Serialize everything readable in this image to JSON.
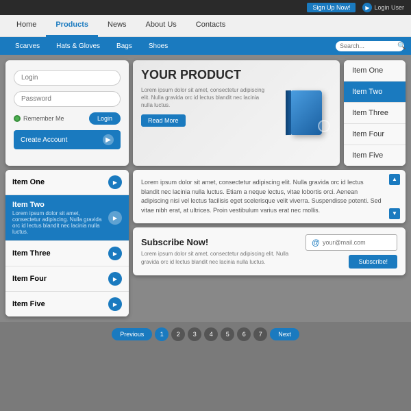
{
  "topbar": {
    "signup_label": "Sign Up Now!",
    "login_label": "Login User"
  },
  "navbar": {
    "items": [
      {
        "label": "Home",
        "active": false
      },
      {
        "label": "Products",
        "active": true
      },
      {
        "label": "News",
        "active": false
      },
      {
        "label": "About Us",
        "active": false
      },
      {
        "label": "Contacts",
        "active": false
      }
    ]
  },
  "subnav": {
    "items": [
      {
        "label": "Scarves"
      },
      {
        "label": "Hats & Gloves"
      },
      {
        "label": "Bags"
      },
      {
        "label": "Shoes"
      }
    ],
    "search_placeholder": "Search..."
  },
  "login": {
    "login_placeholder": "Login",
    "password_placeholder": "Password",
    "remember_label": "Remember Me",
    "login_btn": "Login",
    "create_account": "Create Account"
  },
  "product": {
    "title": "YOUR PRODUCT",
    "description": "Lorem ipsum dolor sit amet, consectetur adipiscing elit. Nulla gravida orc id lectus blandit nec lacinia nulla luctus.",
    "read_more": "Read More"
  },
  "items_right": [
    {
      "label": "Item One",
      "active": false
    },
    {
      "label": "Item Two",
      "active": true
    },
    {
      "label": "Item Three",
      "active": false
    },
    {
      "label": "Item Four",
      "active": false
    },
    {
      "label": "Item Five",
      "active": false
    }
  ],
  "items_left": [
    {
      "label": "Item One",
      "desc": "",
      "active": false
    },
    {
      "label": "Item Two",
      "desc": "Lorem ipsum dolor sit amet, consectetur adipiscing. Nulla gravida orc id lectus blandit nec lacinia nulla luctus.",
      "active": true
    },
    {
      "label": "Item Three",
      "desc": "",
      "active": false
    },
    {
      "label": "Item Four",
      "desc": "",
      "active": false
    },
    {
      "label": "Item Five",
      "desc": "",
      "active": false
    }
  ],
  "content_text": "Lorem ipsum dolor sit amet, consectetur adipiscing elit. Nulla gravida orc id lectus blandit nec lacinia nulla luctus. Etiam a neque lectus, vitae lobortis orci. Aenean adipiscing nisi vel lectus facilisis eget scelerisque velit viverra. Suspendisse potenti. Sed vitae nibh erat, at ultrices. Proin vestibulum varius erat nec mollis.",
  "subscribe": {
    "title": "Subscribe Now!",
    "desc": "Lorem ipsum dolor sit amet, consectetur adipiscing elit. Nulla gravida orc id lectus blandit nec lacinia nulla luctus.",
    "email_placeholder": "your@mail.com",
    "btn_label": "Subscribe!"
  },
  "pagination": {
    "prev": "Previous",
    "next": "Next",
    "pages": [
      "1",
      "2",
      "3",
      "4",
      "5",
      "6",
      "7"
    ],
    "active_page": 1
  }
}
